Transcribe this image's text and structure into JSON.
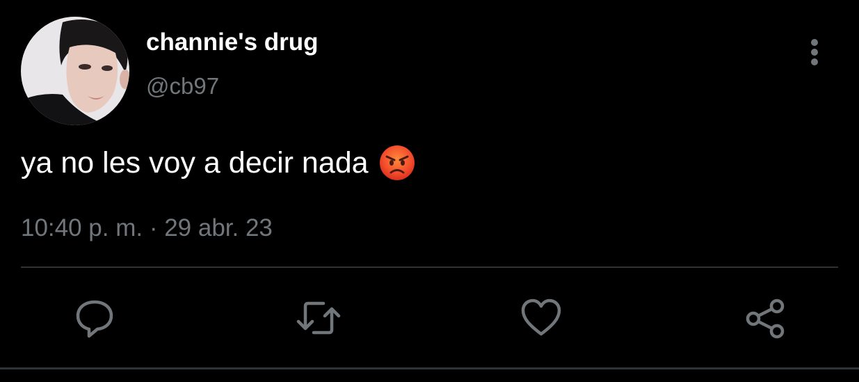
{
  "tweet": {
    "author": {
      "display_name": "channie's drug",
      "handle": "@cb97",
      "avatar": "avatar-photo"
    },
    "text": "ya no les voy a decir nada",
    "emoji": "pouting-face-emoji",
    "timestamp": "10:40 p. m. · 29 abr. 23"
  },
  "icons": {
    "more": "more-vertical-icon",
    "reply": "reply-icon",
    "retweet": "retweet-icon",
    "like": "heart-icon",
    "share": "share-icon"
  },
  "colors": {
    "background": "#000000",
    "primary_text": "#ffffff",
    "secondary_text": "#71767b",
    "divider": "#2f3336",
    "icon": "#71767b"
  }
}
